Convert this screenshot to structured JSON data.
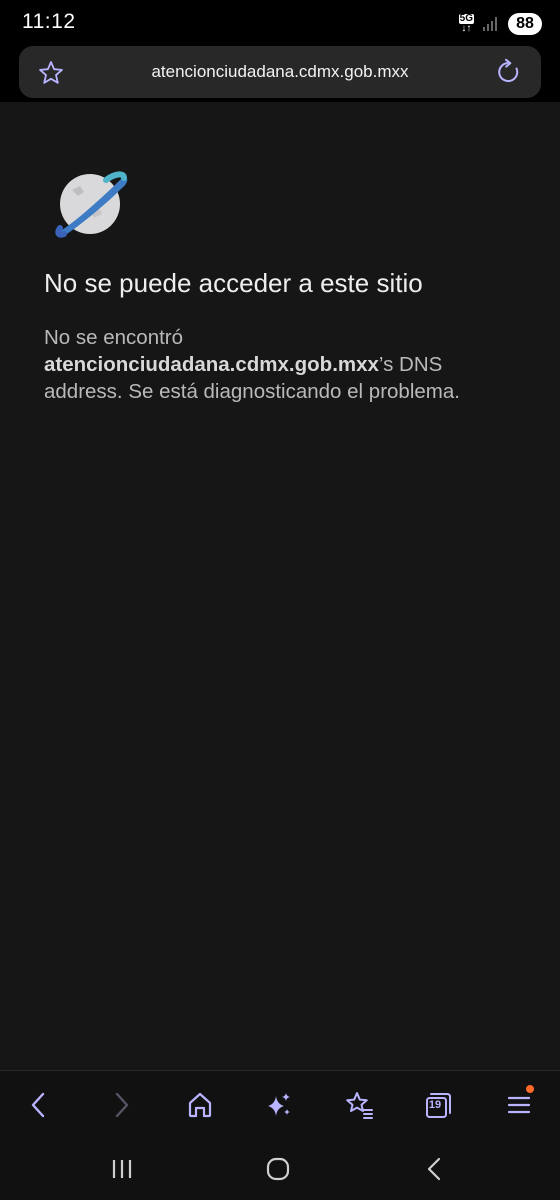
{
  "status_bar": {
    "time": "11:12",
    "network": "5G",
    "battery": "88"
  },
  "browser": {
    "url": "atencionciudadana.cdmx.gob.mxx"
  },
  "error_page": {
    "title": "No se puede acceder a este sitio",
    "body_prefix": "No se encontró",
    "host": "atencionciudadana.cdmx.gob.mxx",
    "body_suffix": "’s DNS address. Se está diagnosticando el problema."
  },
  "toolbar": {
    "tabs_count": "19"
  },
  "colors": {
    "accent": "#b9b4ff",
    "menu_badge": "#ff6a2b",
    "background": "#161616"
  },
  "icons": [
    "star-icon",
    "reload-icon",
    "globe-icon",
    "back-icon",
    "forward-icon",
    "home-icon",
    "sparkle-icon",
    "bookmarks-icon",
    "tabs-icon",
    "menu-icon",
    "recents-icon",
    "home-nav-icon",
    "back-nav-icon"
  ]
}
